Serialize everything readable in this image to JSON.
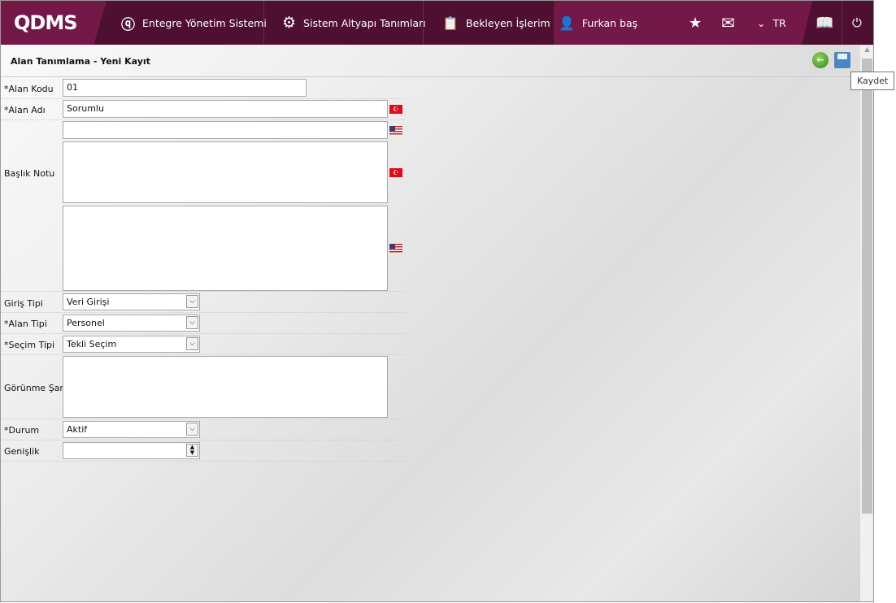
{
  "nav": {
    "logo": "QDMS",
    "items": [
      "Entegre Yönetim Sistemi",
      "Sistem Altyapı Tanımları",
      "Bekleyen İşlerim",
      "Furkan baş"
    ],
    "lang": "TR"
  },
  "page": {
    "title": "Alan Tanımlama - Yeni Kayıt",
    "tooltip": "Kaydet"
  },
  "form": {
    "alan_kodu": {
      "label": "*Alan Kodu",
      "value": "01"
    },
    "alan_adi": {
      "label": "*Alan Adı",
      "value_tr": "Sorumlu",
      "value_en": ""
    },
    "baslik_notu": {
      "label": "Başlık Notu"
    },
    "giris_tipi": {
      "label": "Giriş Tipi",
      "value": "Veri Girişi"
    },
    "alan_tipi": {
      "label": "*Alan Tipi",
      "value": "Personel"
    },
    "secim_tipi": {
      "label": "*Seçim Tipi",
      "value": "Tekli Seçim"
    },
    "gorunme_sarti": {
      "label": "Görünme Şartı"
    },
    "durum": {
      "label": "*Durum",
      "value": "Aktif"
    },
    "genislik": {
      "label": "Genişlik",
      "value": ""
    }
  }
}
